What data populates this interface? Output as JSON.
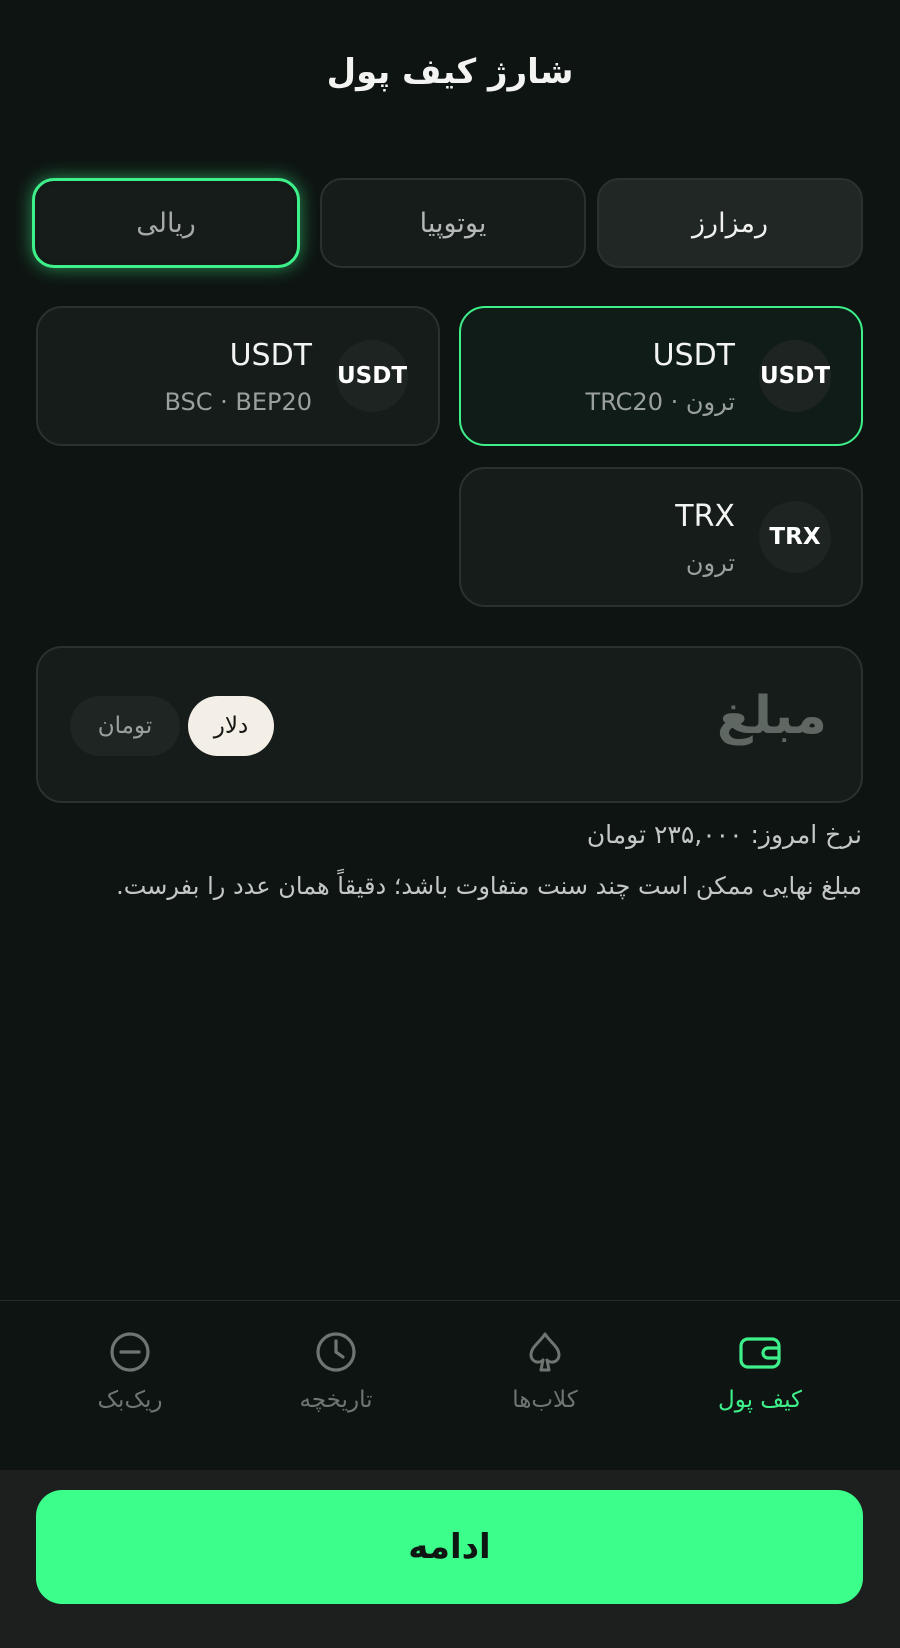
{
  "header": {
    "title": "شارژ کیف پول"
  },
  "methods": {
    "crypto": "رمزارز",
    "utopia": "یوتوپیا",
    "rial": "ریالی"
  },
  "coins": [
    {
      "badge": "USDT",
      "name": "USDT",
      "network": "ترون · TRC20",
      "selected": true
    },
    {
      "badge": "USDT",
      "name": "USDT",
      "network": "BSC · BEP20",
      "selected": false
    },
    {
      "badge": "TRX",
      "name": "TRX",
      "network": "ترون",
      "selected": false
    }
  ],
  "amount": {
    "placeholder": "مبلغ",
    "currency_usd": "دلار",
    "currency_toman": "تومان",
    "selected_currency": "دلار"
  },
  "rate_text": "نرخ امروز: ۲۳۵,۰۰۰ تومان",
  "note_text": "مبلغ نهایی ممکن است چند سنت متفاوت باشد؛ دقیقاً همان عدد را بفرست.",
  "nav": {
    "wallet": "کیف پول",
    "clubs": "کلاب‌ها",
    "history": "تاریخچه",
    "rakeback": "ریک‌بک",
    "active": "wallet"
  },
  "footer": {
    "continue_label": "ادامه"
  },
  "colors": {
    "accent": "#3ef08a",
    "background": "#0e1412",
    "cta": "#3cfe8a"
  },
  "icons": {
    "wallet": "wallet-icon",
    "clubs": "spade-icon",
    "history": "clock-icon",
    "rakeback": "minus-circle-icon"
  }
}
